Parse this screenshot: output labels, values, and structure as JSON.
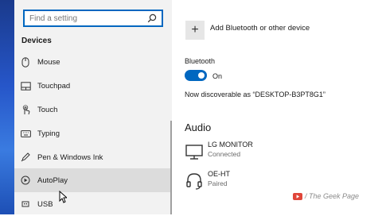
{
  "sidebar": {
    "search_placeholder": "Find a setting",
    "section_title": "Devices",
    "items": [
      {
        "label": "Mouse",
        "icon": "mouse-icon"
      },
      {
        "label": "Touchpad",
        "icon": "touchpad-icon"
      },
      {
        "label": "Touch",
        "icon": "touch-icon"
      },
      {
        "label": "Typing",
        "icon": "keyboard-icon"
      },
      {
        "label": "Pen & Windows Ink",
        "icon": "pen-icon"
      },
      {
        "label": "AutoPlay",
        "icon": "autoplay-icon",
        "selected": true
      },
      {
        "label": "USB",
        "icon": "usb-icon"
      }
    ]
  },
  "main": {
    "add_device_label": "Add Bluetooth or other device",
    "bluetooth_label": "Bluetooth",
    "bluetooth_state": "On",
    "bluetooth_on": true,
    "discoverable_text": "Now discoverable as “DESKTOP-B3PT8G1”",
    "audio_heading": "Audio",
    "audio_devices": [
      {
        "name": "LG MONITOR",
        "status": "Connected",
        "icon": "monitor-icon"
      },
      {
        "name": "OE-HT",
        "status": "Paired",
        "icon": "headset-icon"
      }
    ]
  },
  "watermark": {
    "text": "/ The Geek Page",
    "icon": "play-icon"
  },
  "colors": {
    "accent": "#0067c0",
    "sidebar_bg": "#f2f2f2",
    "selected_bg": "#dcdcdc"
  }
}
